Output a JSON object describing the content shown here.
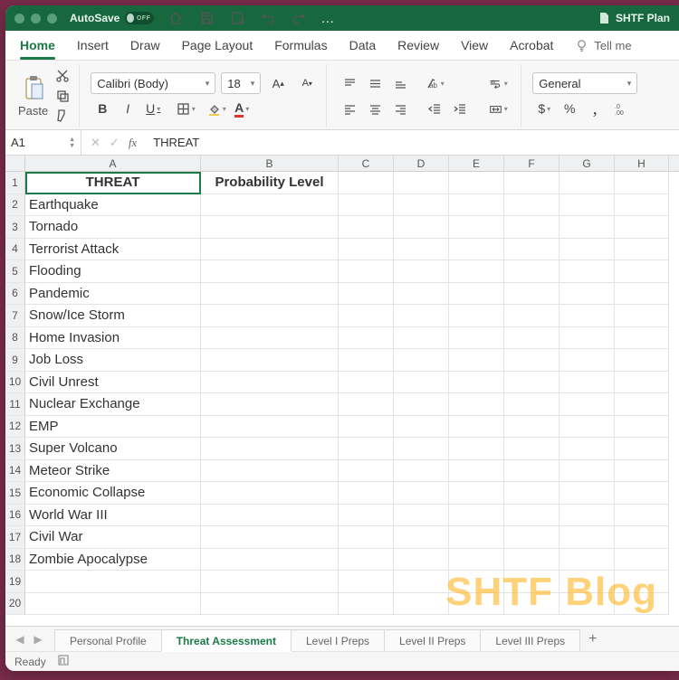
{
  "titlebar": {
    "autosave_label": "AutoSave",
    "autosave_state": "OFF",
    "filename": "SHTF Plan"
  },
  "ribbon": {
    "tabs": [
      "Home",
      "Insert",
      "Draw",
      "Page Layout",
      "Formulas",
      "Data",
      "Review",
      "View",
      "Acrobat"
    ],
    "active_tab": "Home",
    "tellme": "Tell me",
    "paste_label": "Paste",
    "font_name": "Calibri (Body)",
    "font_size": "18",
    "bold": "B",
    "italic": "I",
    "underline": "U",
    "number_format": "General",
    "currency": "$",
    "percent": "%",
    "comma": ","
  },
  "formula_bar": {
    "cell_ref": "A1",
    "fx_label": "fx",
    "value": "THREAT"
  },
  "columns": [
    "A",
    "B",
    "C",
    "D",
    "E",
    "F",
    "G",
    "H"
  ],
  "rows": 20,
  "headers": {
    "A": "THREAT",
    "B": "Probability Level"
  },
  "threats": [
    "Earthquake",
    "Tornado",
    "Terrorist Attack",
    "Flooding",
    "Pandemic",
    "Snow/Ice Storm",
    "Home Invasion",
    "Job Loss",
    "Civil Unrest",
    "Nuclear Exchange",
    "EMP",
    "Super Volcano",
    "Meteor Strike",
    "Economic Collapse",
    "World War III",
    "Civil War",
    "Zombie Apocalypse"
  ],
  "sheets": {
    "tabs": [
      "Personal Profile",
      "Threat Assessment",
      "Level I Preps",
      "Level II Preps",
      "Level III Preps"
    ],
    "active": "Threat Assessment"
  },
  "status": {
    "ready": "Ready"
  },
  "watermark": "SHTF Blog"
}
